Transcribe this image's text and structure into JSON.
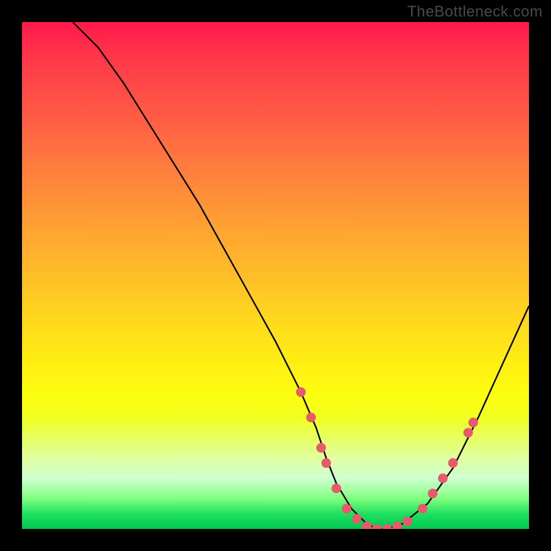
{
  "watermark": "TheBottleneck.com",
  "chart_data": {
    "type": "line",
    "title": "",
    "xlabel": "",
    "ylabel": "",
    "xlim": [
      0,
      100
    ],
    "ylim": [
      0,
      100
    ],
    "grid": false,
    "series": [
      {
        "name": "curve",
        "x": [
          10,
          15,
          20,
          25,
          30,
          35,
          40,
          45,
          50,
          55,
          58,
          60,
          62,
          65,
          68,
          70,
          72,
          75,
          80,
          85,
          90,
          95,
          100
        ],
        "y": [
          100,
          95,
          88,
          80,
          72,
          64,
          55,
          46,
          37,
          27,
          20,
          14,
          9,
          4,
          1,
          0,
          0,
          1,
          5,
          12,
          22,
          33,
          44
        ]
      }
    ],
    "markers": [
      {
        "x": 55,
        "y": 27
      },
      {
        "x": 57,
        "y": 22
      },
      {
        "x": 59,
        "y": 16
      },
      {
        "x": 60,
        "y": 13
      },
      {
        "x": 62,
        "y": 8
      },
      {
        "x": 64,
        "y": 4
      },
      {
        "x": 66,
        "y": 2
      },
      {
        "x": 68,
        "y": 0.5
      },
      {
        "x": 70,
        "y": 0
      },
      {
        "x": 72,
        "y": 0
      },
      {
        "x": 74,
        "y": 0.5
      },
      {
        "x": 76,
        "y": 1.5
      },
      {
        "x": 79,
        "y": 4
      },
      {
        "x": 81,
        "y": 7
      },
      {
        "x": 83,
        "y": 10
      },
      {
        "x": 85,
        "y": 13
      },
      {
        "x": 88,
        "y": 19
      },
      {
        "x": 89,
        "y": 21
      }
    ],
    "marker_color": "#e85a6a",
    "curve_color": "#000000"
  }
}
